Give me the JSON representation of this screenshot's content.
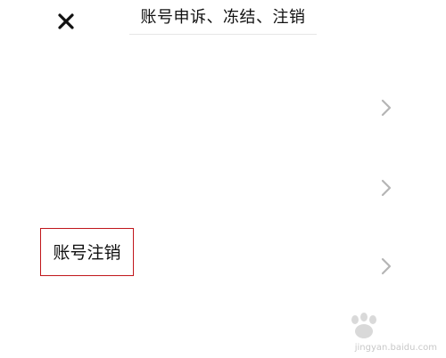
{
  "header": {
    "title": "账号申诉、冻结、注销",
    "close_icon": "close-icon"
  },
  "rows": [
    {
      "label": "",
      "icon": "chevron-right-icon"
    },
    {
      "label": "",
      "icon": "chevron-right-icon"
    },
    {
      "label": "账号注销",
      "icon": "chevron-right-icon",
      "highlight_color": "#c0161b"
    }
  ],
  "watermark": {
    "text": "jingyan.baidu.com"
  }
}
